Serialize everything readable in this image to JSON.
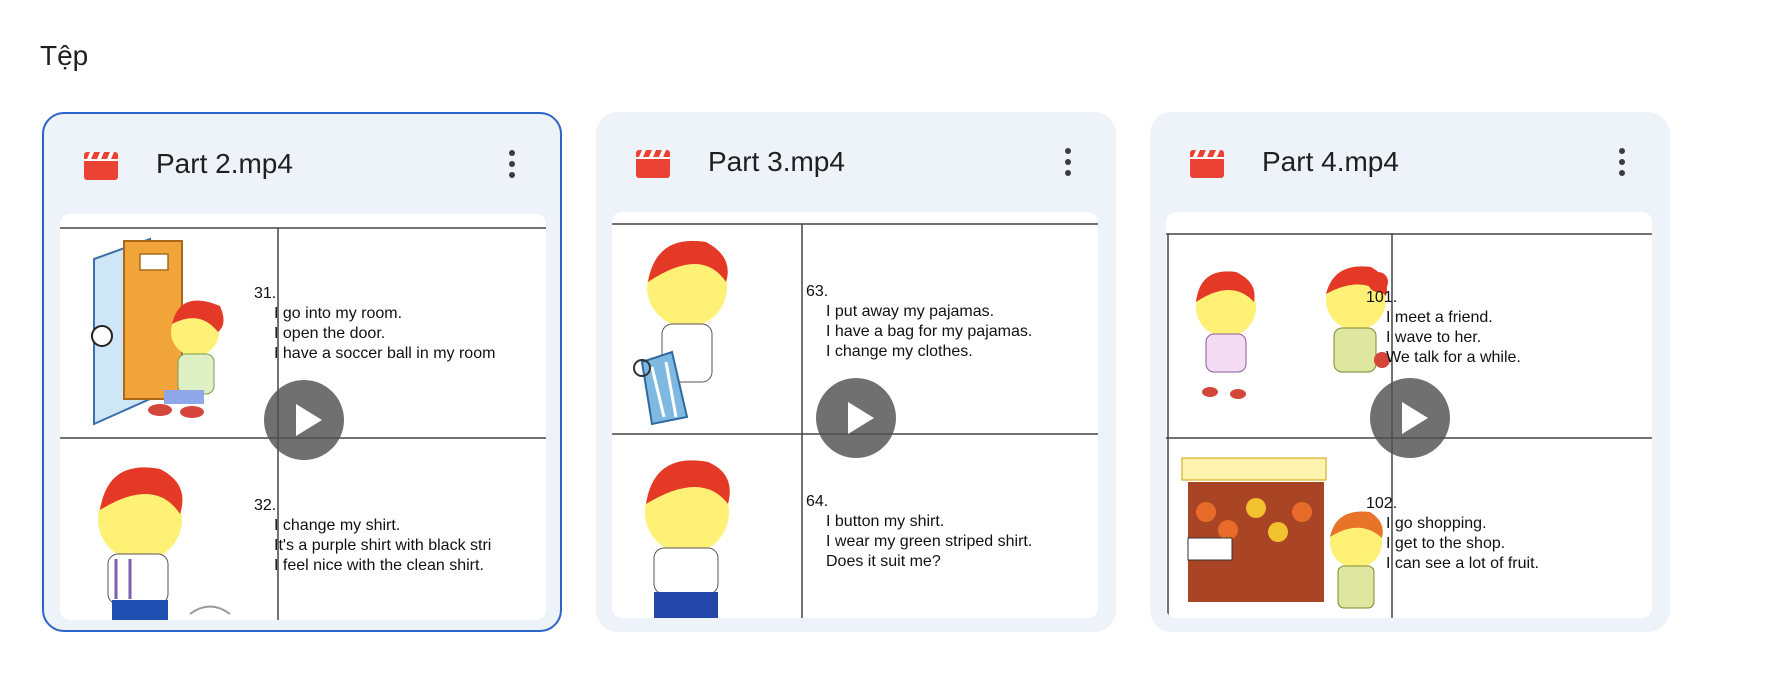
{
  "section": {
    "title": "Tệp"
  },
  "files": [
    {
      "name": "Part 2.mp4",
      "selected": true,
      "entries": [
        {
          "num": "31.",
          "lines": [
            "I go into my room.",
            "I open the door.",
            "I have a soccer ball in my room"
          ]
        },
        {
          "num": "32.",
          "lines": [
            "I change my shirt.",
            "It's a purple shirt with black stri",
            "I feel nice with the clean shirt."
          ]
        }
      ]
    },
    {
      "name": "Part 3.mp4",
      "selected": false,
      "entries": [
        {
          "num": "63.",
          "lines": [
            "I put away my pajamas.",
            "I have a bag for my pajamas.",
            "I change my clothes."
          ]
        },
        {
          "num": "64.",
          "lines": [
            "I button my shirt.",
            "I wear my green striped shirt.",
            "Does it suit me?"
          ]
        }
      ]
    },
    {
      "name": "Part 4.mp4",
      "selected": false,
      "entries": [
        {
          "num": "101.",
          "lines": [
            "I meet a friend.",
            "I wave to her.",
            "We talk for a while."
          ]
        },
        {
          "num": "102.",
          "lines": [
            "I go shopping.",
            "I get to the shop.",
            "I can see a lot of fruit."
          ]
        }
      ]
    }
  ],
  "icons": {
    "file_type": "video-file-icon",
    "menu": "more-vertical-icon",
    "play": "play-icon"
  },
  "colors": {
    "card_bg": "#eef2f9",
    "selected_border": "#2d64c7",
    "video_icon": "#ea4335",
    "play_bg": "#505050"
  }
}
